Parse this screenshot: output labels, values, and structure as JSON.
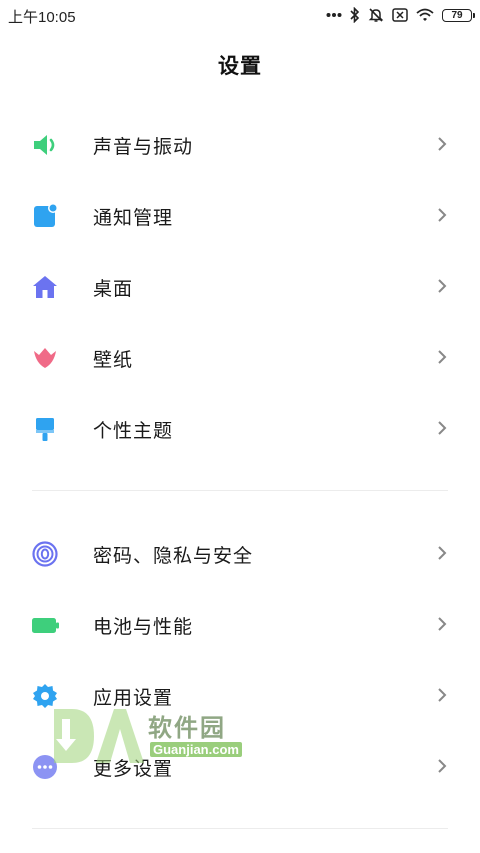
{
  "status_bar": {
    "time": "上午10:05",
    "battery_level": "79",
    "icons": [
      "more-dots-icon",
      "bluetooth-icon",
      "mute-icon",
      "sim-off-icon",
      "wifi-icon",
      "battery-icon"
    ]
  },
  "page": {
    "title": "设置"
  },
  "sections": [
    {
      "items": [
        {
          "label": "声音与振动",
          "icon": "speaker-icon",
          "color": "#3ecf7c"
        },
        {
          "label": "通知管理",
          "icon": "notification-icon",
          "color": "#2fa3f0"
        },
        {
          "label": "桌面",
          "icon": "home-icon",
          "color": "#6b73f0"
        },
        {
          "label": "壁纸",
          "icon": "tulip-icon",
          "color": "#f06a87"
        },
        {
          "label": "个性主题",
          "icon": "paint-brush-icon",
          "color": "#2fa3f0"
        }
      ]
    },
    {
      "items": [
        {
          "label": "密码、隐私与安全",
          "icon": "fingerprint-icon",
          "color": "#6b73f0"
        },
        {
          "label": "电池与性能",
          "icon": "battery-icon",
          "color": "#3ecf7c"
        },
        {
          "label": "应用设置",
          "icon": "gear-icon",
          "color": "#2fa3f0"
        },
        {
          "label": "更多设置",
          "icon": "more-icon",
          "color": "#6b73f0"
        }
      ]
    }
  ],
  "watermark": {
    "text": "软件园",
    "subtext": "Guanjian.com"
  }
}
